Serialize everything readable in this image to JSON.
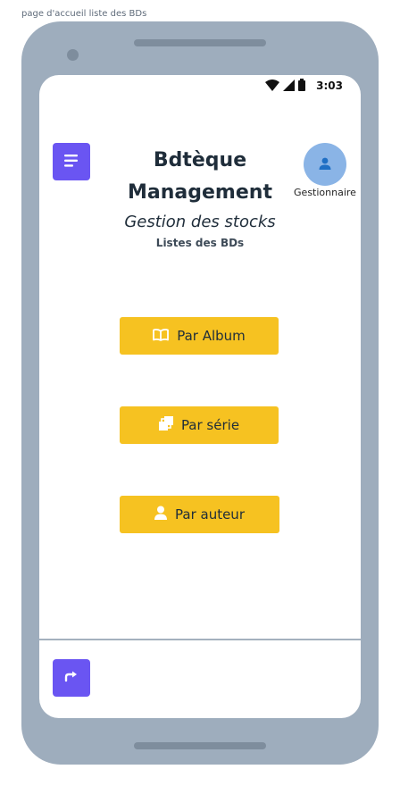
{
  "caption": "page d'accueil liste des BDs",
  "status": {
    "time": "3:03"
  },
  "header": {
    "title_line1": "Bdtèque",
    "title_line2": "Management",
    "subtitle": "Gestion des stocks",
    "section": "Listes des BDs",
    "user_label": "Gestionnaire"
  },
  "buttons": {
    "album": "Par Album",
    "serie": "Par série",
    "auteur": "Par auteur"
  },
  "colors": {
    "accent": "#6a55f2",
    "button_yellow": "#f6c221",
    "avatar_blue": "#8ab4e6",
    "phone_frame": "#9eadbd"
  },
  "icons": [
    "menu-icon",
    "user-icon",
    "book-open-icon",
    "copy-icon",
    "user-icon",
    "logout-arrow-icon",
    "wifi-icon",
    "signal-icon",
    "battery-icon"
  ]
}
